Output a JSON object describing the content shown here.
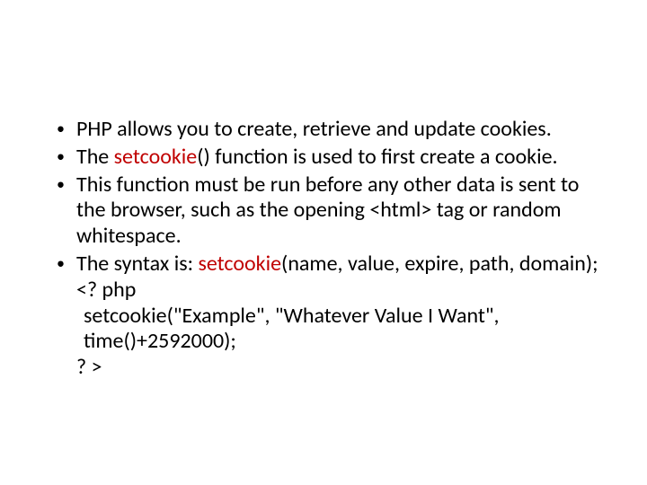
{
  "bullets": {
    "b1": "PHP allows you to create, retrieve and update cookies.",
    "b2a": "The ",
    "b2b": "setcookie",
    "b2c": "() function is used to first create a cookie.",
    "b3": "This function must be run before any other data is sent to the browser, such as the opening <html> tag or random whitespace.",
    "b4a": "The syntax is: ",
    "b4b": "setcookie",
    "b4c": "(name, value, expire, path, domain);",
    "b4_line2": "<? php",
    "b4_line3": " setcookie(\"Example\", \"Whatever Value I Want\", time()+2592000);",
    "b4_line4": "? >"
  }
}
